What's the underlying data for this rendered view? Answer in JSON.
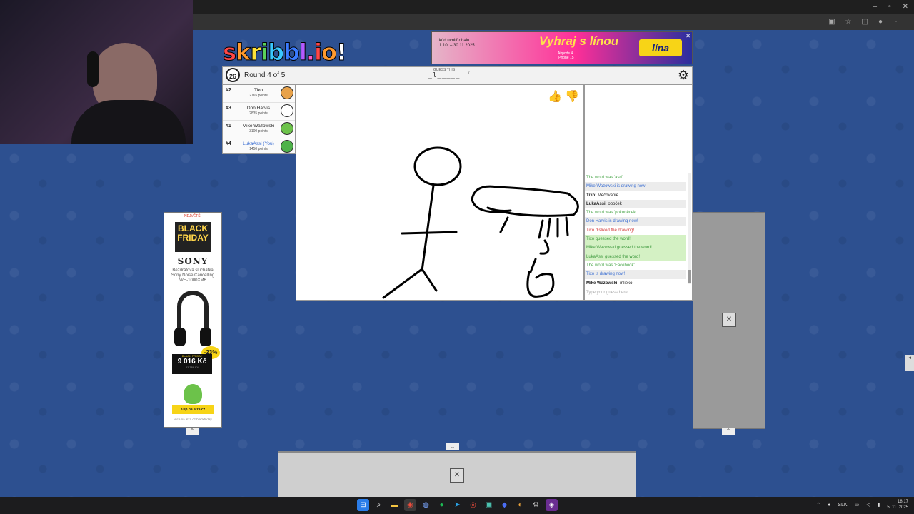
{
  "browser": {
    "window_controls": [
      "–",
      "▫",
      "✕"
    ]
  },
  "game": {
    "logo": "skribbl.io",
    "timer": "26",
    "round": "Round 4 of 5",
    "guess_label": "GUESS THIS",
    "word_hint": "_l_____",
    "word_length": "7",
    "votes": {
      "like": "👍",
      "dislike": "👎"
    }
  },
  "players": [
    {
      "rank": "#2",
      "name": "Tixo",
      "points": "2765 points",
      "color": "#e8a24a"
    },
    {
      "rank": "#3",
      "name": "Don Harvis",
      "points": "2835 points",
      "color": "#ffffff"
    },
    {
      "rank": "#1",
      "name": "Mike Wazowski",
      "points": "3100 points",
      "color": "#6cc24a"
    },
    {
      "rank": "#4",
      "name": "LukaAssi (You)",
      "points": "1450 points",
      "color": "#4fb24a"
    }
  ],
  "chat": {
    "messages": [
      {
        "text": "The word was 'asd'",
        "style": "good"
      },
      {
        "text": "Mike Wazowski is drawing now!",
        "style": "blue alt"
      },
      {
        "user": "Tixo:",
        "text": " Mečovanie",
        "style": ""
      },
      {
        "user": "LukaAssi:",
        "text": " oboček",
        "style": "alt"
      },
      {
        "text": "The word was 'pokoněcek'",
        "style": "good"
      },
      {
        "text": "Don Harvis is drawing now!",
        "style": "blue alt"
      },
      {
        "text": "Tixo disliked the drawing!",
        "style": "red"
      },
      {
        "text": "Tixo guessed the word!",
        "style": "ok"
      },
      {
        "text": "Mike Wazowski guessed the word!",
        "style": "ok"
      },
      {
        "text": "LukaAssi guessed the word!",
        "style": "ok"
      },
      {
        "text": "The word was 'Facebook'",
        "style": "good"
      },
      {
        "text": "Tixo is drawing now!",
        "style": "blue alt"
      },
      {
        "user": "Mike Wazowski:",
        "text": " mlieko",
        "style": ""
      }
    ],
    "input_placeholder": "Type your guess here..."
  },
  "top_ad": {
    "promo": "kód uvnitř obalu\n1.10. – 30.11.2025",
    "headline": "Vyhraj s línou",
    "sub": "Airpods 4\niPhone 15",
    "brand": "lína"
  },
  "side_ad": {
    "top": "NEJVĚTŠÍ",
    "banner": "BLACK FRIDAY",
    "brand": "SONY",
    "product": "Bezdrátová sluchátka Sony Noise Cancelling WH-1000XM6",
    "discount": "-23%",
    "price_label": "BLACK FRIDAY",
    "price": "9 016 Kč",
    "old_price": "11 769 Kč",
    "cta": "Kup na alza.cz",
    "footer": "Více na alza.cz/blackfriday"
  },
  "taskbar": {
    "lang": "SLK",
    "time": "18:17",
    "date": "5. 11. 2025"
  },
  "icons": {
    "broken": "✕",
    "chevron_up": "⌃",
    "chevron_down": "⌄",
    "settings": "⚙"
  }
}
